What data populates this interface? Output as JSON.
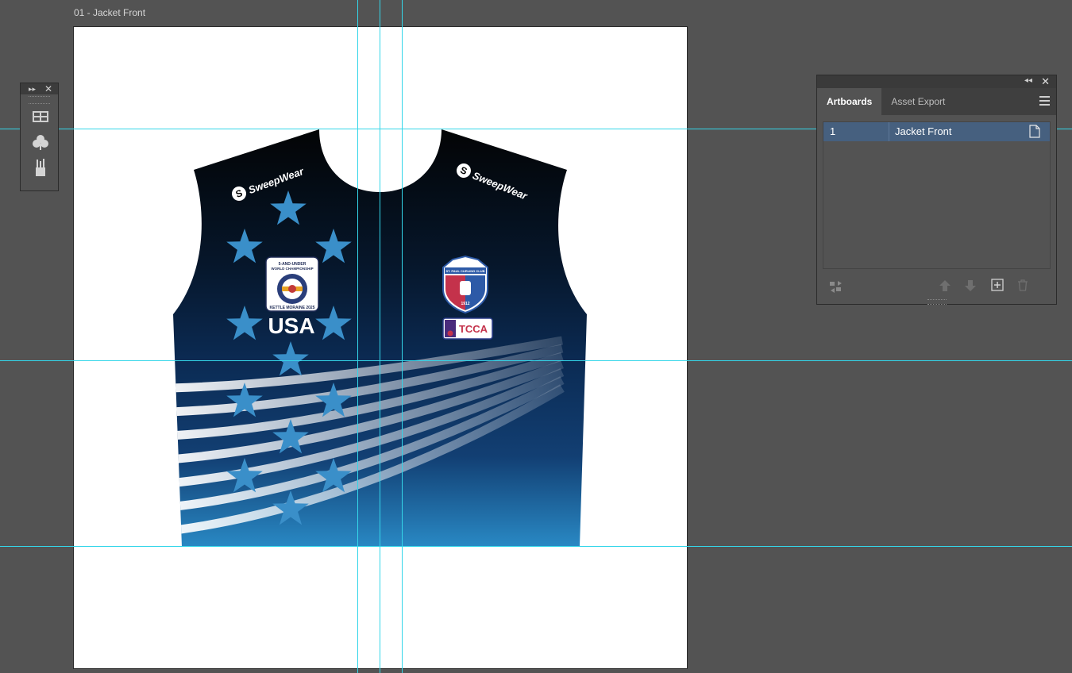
{
  "document": {
    "artboard_title": "01 - Jacket Front"
  },
  "jacket": {
    "brand_left": "SweepWear",
    "brand_right": "SweepWear",
    "country": "USA",
    "badge_left": {
      "line1": "5-AND-UNDER",
      "line2": "WORLD CHAMPIONSHIP",
      "line3": "KETTLE MORAINE 2025"
    },
    "badge_right": {
      "club": "ST. PAUL CURLING CLUB",
      "year": "1912"
    },
    "tcca": "TCCA",
    "colors": {
      "top": "#030303",
      "mid": "#0b2a52",
      "bottom": "#2a8cc8",
      "star": "#3a8fc9"
    }
  },
  "tool_panel": {
    "tools": [
      "artboard-grid-icon",
      "club-symbol-icon",
      "brush-cup-icon"
    ]
  },
  "artboards_panel": {
    "tabs": [
      "Artboards",
      "Asset Export"
    ],
    "active_tab": "Artboards",
    "items": [
      {
        "number": "1",
        "name": "Jacket Front"
      }
    ],
    "footer_icons": [
      "rearrange-icon",
      "move-up-icon",
      "move-down-icon",
      "new-artboard-icon",
      "delete-icon"
    ]
  },
  "theme": {
    "guide_color": "#34d6e9",
    "background": "#535353",
    "selection": "#46607f"
  }
}
